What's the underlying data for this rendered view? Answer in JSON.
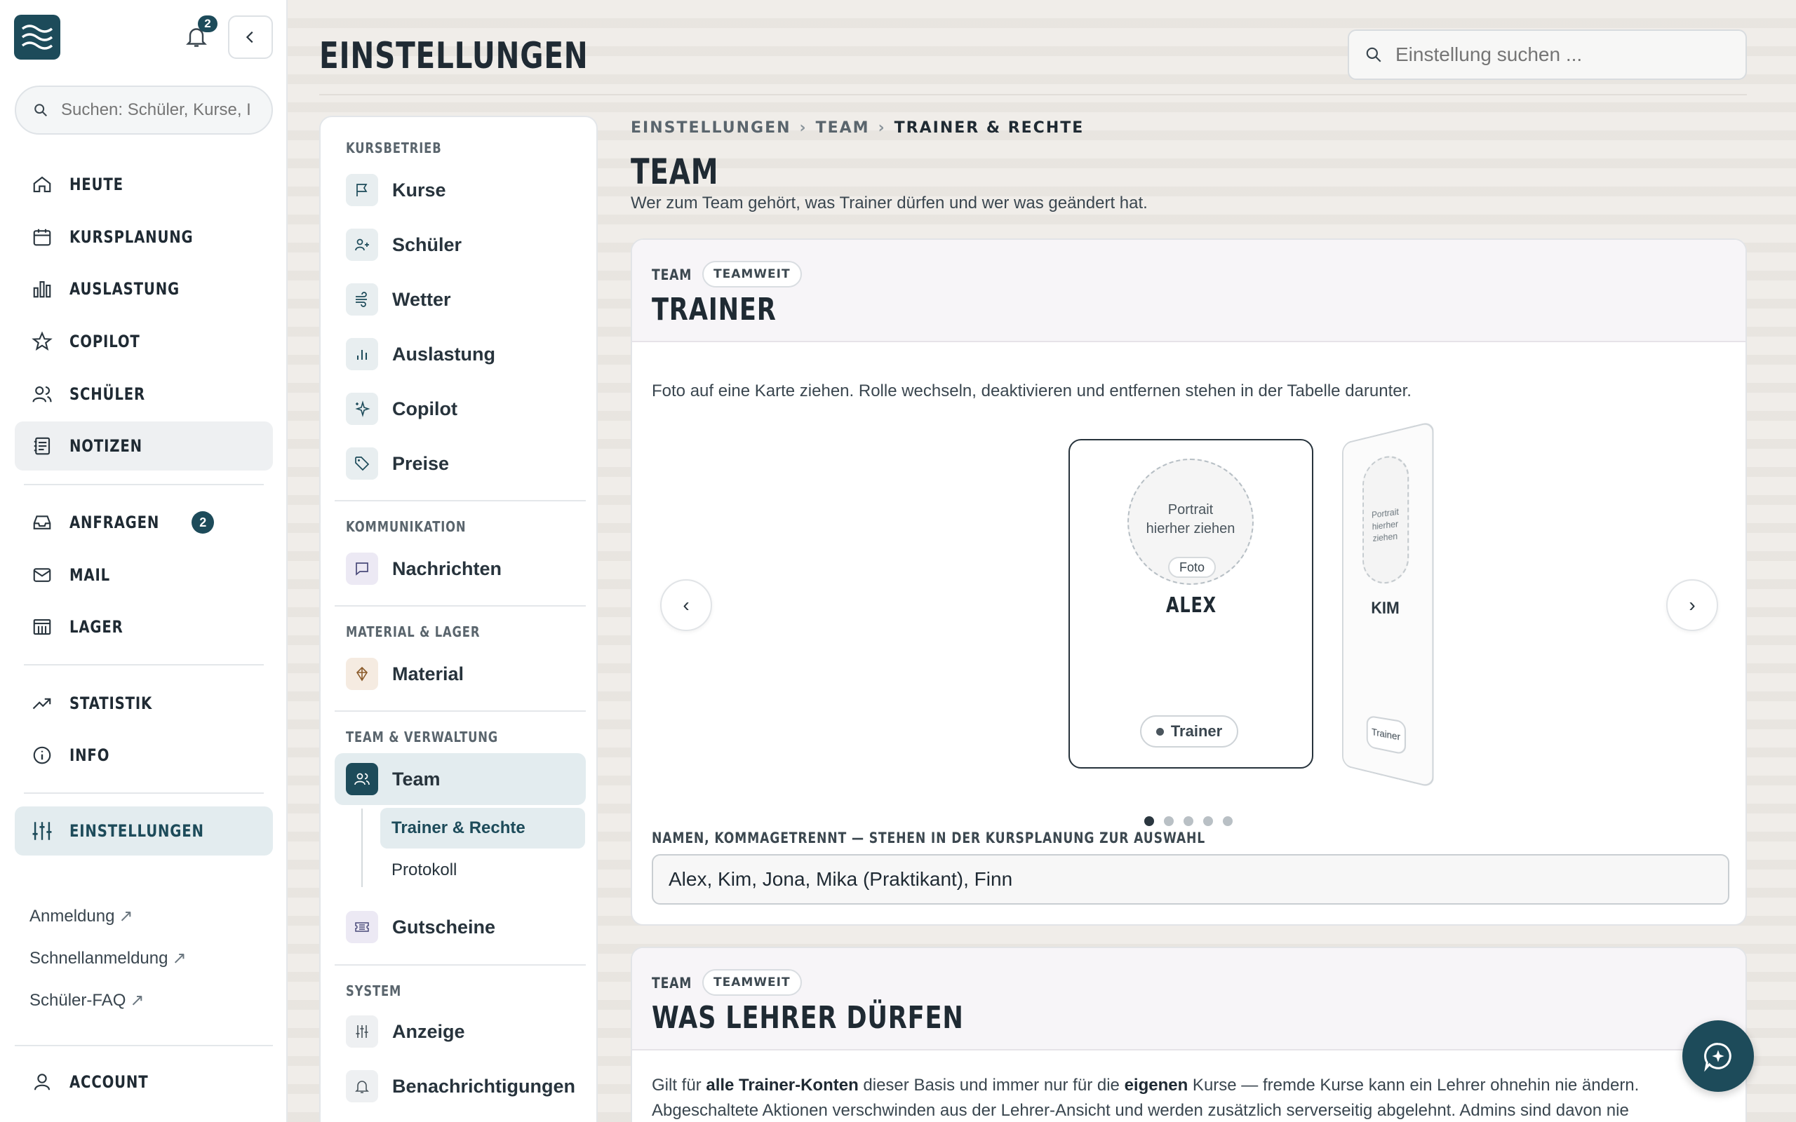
{
  "sidebar": {
    "notifications_count": "2",
    "search_placeholder": "Suchen: Schüler, Kurse, I",
    "nav": [
      {
        "label": "HEUTE",
        "icon": "home-icon"
      },
      {
        "label": "KURSPLANUNG",
        "icon": "calendar-icon"
      },
      {
        "label": "AUSLASTUNG",
        "icon": "bar-chart-icon"
      },
      {
        "label": "COPILOT",
        "icon": "star-icon"
      },
      {
        "label": "SCHÜLER",
        "icon": "users-icon"
      },
      {
        "label": "NOTIZEN",
        "icon": "notes-icon"
      },
      {
        "label": "ANFRAGEN",
        "icon": "inbox-icon",
        "badge": "2"
      },
      {
        "label": "MAIL",
        "icon": "mail-icon"
      },
      {
        "label": "LAGER",
        "icon": "warehouse-icon"
      },
      {
        "label": "STATISTIK",
        "icon": "trend-icon"
      },
      {
        "label": "INFO",
        "icon": "info-icon"
      },
      {
        "label": "EINSTELLUNGEN",
        "icon": "sliders-icon"
      }
    ],
    "links": [
      "Anmeldung",
      "Schnellanmeldung",
      "Schüler-FAQ"
    ],
    "link_arrow": "↗",
    "account": "ACCOUNT"
  },
  "header": {
    "title": "EINSTELLUNGEN",
    "search_placeholder": "Einstellung suchen ..."
  },
  "subnav": {
    "sections": [
      {
        "title": "KURSBETRIEB",
        "items": [
          "Kurse",
          "Schüler",
          "Wetter",
          "Auslastung",
          "Copilot",
          "Preise"
        ]
      },
      {
        "title": "KOMMUNIKATION",
        "items": [
          "Nachrichten"
        ]
      },
      {
        "title": "MATERIAL & LAGER",
        "items": [
          "Material"
        ]
      },
      {
        "title": "TEAM & VERWALTUNG",
        "items": [
          "Team",
          "Gutscheine"
        ]
      },
      {
        "title": "SYSTEM",
        "items": [
          "Anzeige",
          "Benachrichtigungen"
        ]
      }
    ],
    "team_children": [
      "Trainer & Rechte",
      "Protokoll"
    ]
  },
  "breadcrumb": [
    "EINSTELLUNGEN",
    "TEAM",
    "TRAINER & RECHTE"
  ],
  "breadcrumb_sep": "›",
  "content": {
    "title": "TEAM",
    "subtitle": "Wer zum Team gehört, was Trainer dürfen und wer was geändert hat."
  },
  "trainer_card": {
    "kicker": "TEAM",
    "chip": "TEAMWEIT",
    "title": "TRAINER",
    "hint": "Foto auf eine Karte ziehen. Rolle wechseln, deaktivieren und entfernen stehen in der Tabelle darunter.",
    "prev": "‹",
    "next": "›",
    "current": {
      "portrait_line1": "Portrait",
      "portrait_line2": "hierher ziehen",
      "photo_btn": "Foto",
      "name": "ALEX",
      "role": "Trainer"
    },
    "next_card": {
      "portrait_line1": "Portrait",
      "portrait_line2": "hierher ziehen",
      "name": "KIM",
      "role": "Trainer"
    },
    "dots_total": 5,
    "dots_active": 1,
    "names_label": "NAMEN, KOMMAGETRENNT — STEHEN IN DER KURSPLANUNG ZUR AUSWAHL",
    "names_value": "Alex, Kim, Jona, Mika (Praktikant), Finn"
  },
  "rights_card": {
    "kicker": "TEAM",
    "chip": "TEAMWEIT",
    "title": "WAS LEHRER DÜRFEN",
    "text_1": "Gilt für ",
    "text_bold_1": "alle Trainer-Konten",
    "text_2": " dieser Basis und immer nur für die ",
    "text_bold_2": "eigenen",
    "text_3": " Kurse — fremde Kurse kann ein Lehrer ohnehin nie ändern. Abgeschaltete Aktionen verschwinden aus der Lehrer-Ansicht und werden zusätzlich serverseitig abgelehnt. Admins sind davon nie"
  },
  "colors": {
    "accent": "#1d4b5a",
    "active_bg": "#e3ecef",
    "text": "#1f2a33"
  }
}
